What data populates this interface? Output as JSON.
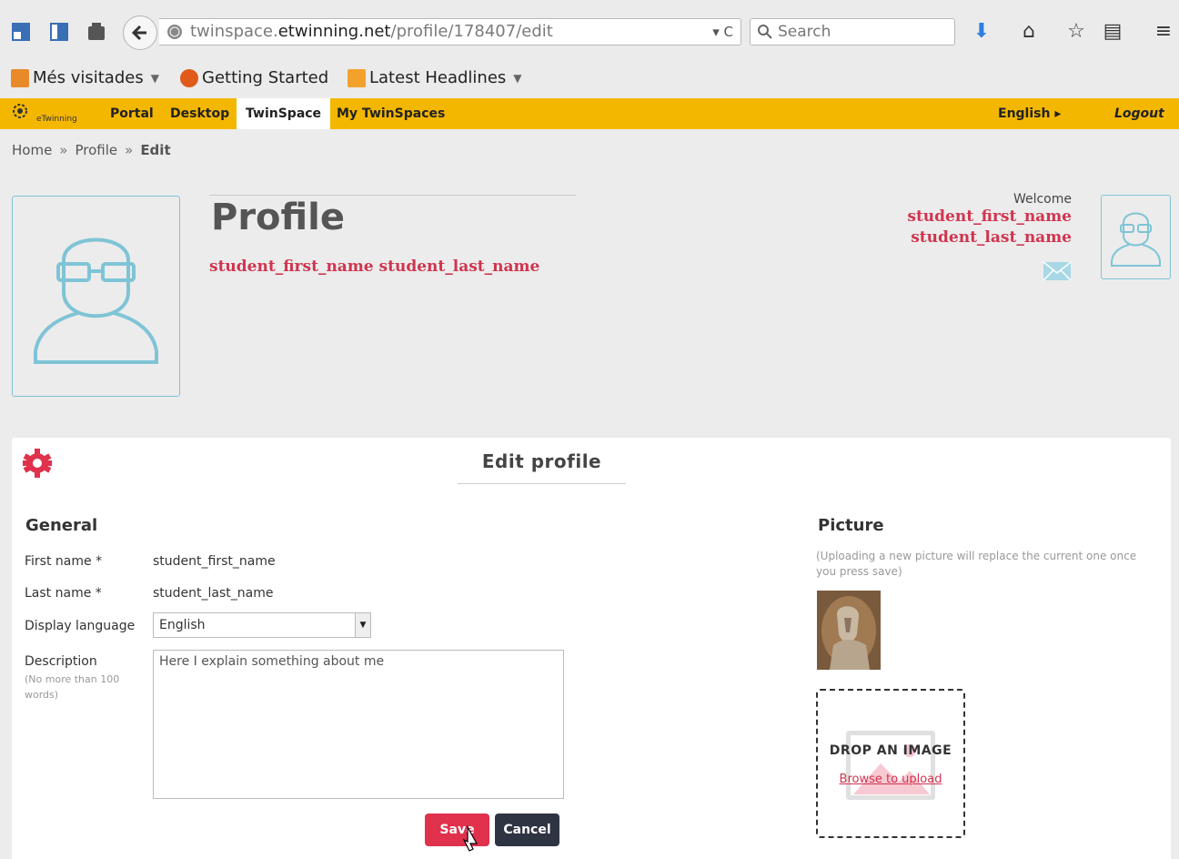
{
  "browser": {
    "url_prefix": "twinspace.",
    "url_domain": "etwinning.net",
    "url_path": "/profile/178407/edit",
    "url_actions": "▾ C",
    "search_placeholder": "Search",
    "bookmarks": [
      {
        "label": "Més visitades",
        "dropdown": true
      },
      {
        "label": "Getting Started",
        "dropdown": false
      },
      {
        "label": "Latest Headlines",
        "dropdown": true
      }
    ]
  },
  "etwinning": {
    "logo_text": "eTwinning",
    "nav": [
      "Portal",
      "Desktop",
      "TwinSpace",
      "My TwinSpaces"
    ],
    "active_nav": "TwinSpace",
    "language": "English ▸",
    "logout": "Logout"
  },
  "breadcrumb": {
    "home": "Home",
    "profile": "Profile",
    "current": "Edit",
    "separator": "»"
  },
  "profile": {
    "title": "Profile",
    "full_name": "student_first_name student_last_name"
  },
  "welcome": {
    "label": "Welcome",
    "first_name": "student_first_name",
    "last_name": "student_last_name"
  },
  "edit": {
    "title": "Edit profile",
    "general": {
      "heading": "General",
      "first_name_label": "First name *",
      "first_name_value": "student_first_name",
      "last_name_label": "Last name *",
      "last_name_value": "student_last_name",
      "language_label": "Display language",
      "language_value": "English",
      "description_label": "Description",
      "description_hint": "(No more than 100 words)",
      "description_value": "Here I explain something about me"
    },
    "picture": {
      "heading": "Picture",
      "hint": "(Uploading a new picture will replace the current one once you press save)",
      "drop_title": "DROP AN IMAGE",
      "drop_link": "Browse to upload"
    },
    "save_label": "Save",
    "cancel_label": "Cancel"
  },
  "colors": {
    "accent_red": "#e0314d",
    "name_red": "#d0344f",
    "etwinning_yellow": "#f4b700",
    "avatar_blue": "#7fc4d6",
    "dark_button": "#2f3443"
  }
}
